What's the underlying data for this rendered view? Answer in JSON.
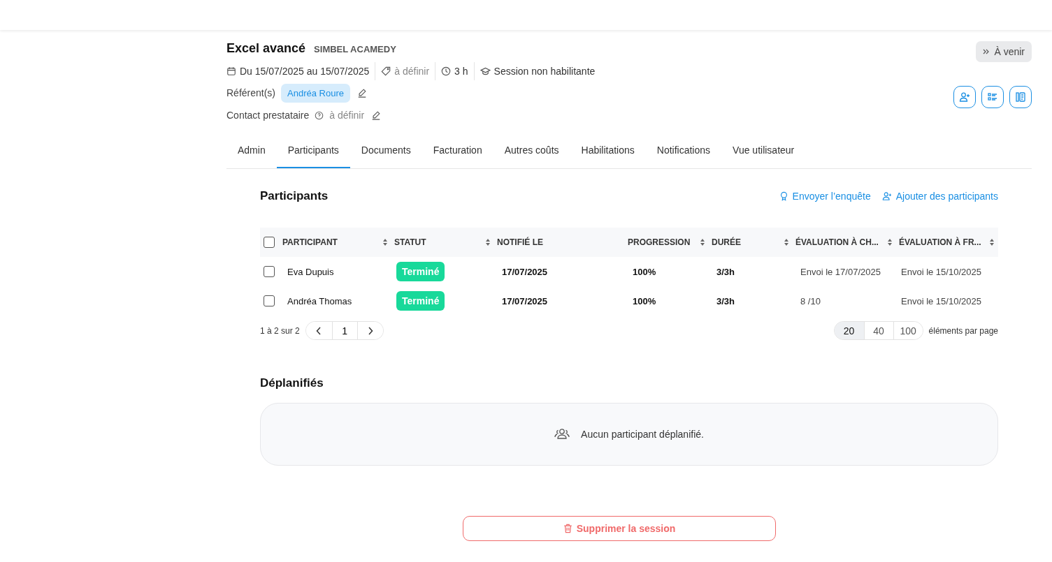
{
  "session": {
    "title": "Excel avancé",
    "provider": "SIMBEL ACAMEDY",
    "status": "À venir",
    "dates": "Du 15/07/2025 au 15/07/2025",
    "price": "à définir",
    "duration": "3 h",
    "qualification": "Session non habilitante"
  },
  "referents": {
    "label": "Référent(s)",
    "chips": [
      "Andréa Roure"
    ]
  },
  "contact": {
    "label": "Contact prestataire",
    "value": "à définir"
  },
  "tabs": [
    {
      "label": "Admin",
      "selected": false
    },
    {
      "label": "Participants",
      "selected": true
    },
    {
      "label": "Documents",
      "selected": false
    },
    {
      "label": "Facturation",
      "selected": false
    },
    {
      "label": "Autres coûts",
      "selected": false
    },
    {
      "label": "Habilitations",
      "selected": false
    },
    {
      "label": "Notifications",
      "selected": false
    },
    {
      "label": "Vue utilisateur",
      "selected": false
    }
  ],
  "participants": {
    "title": "Participants",
    "actions": [
      "Envoyer l’enquête",
      "Ajouter des participants"
    ],
    "columns": [
      {
        "label": "PARTICIPANT",
        "sortable": true
      },
      {
        "label": "STATUT",
        "sortable": true
      },
      {
        "label": "NOTIFIÉ LE",
        "sortable": false
      },
      {
        "label": "PROGRESSION",
        "sortable": true
      },
      {
        "label": "DURÉE",
        "sortable": true
      },
      {
        "label": "ÉVALUATION À CH...",
        "sortable": true
      },
      {
        "label": "ÉVALUATION À FR...",
        "sortable": true
      }
    ],
    "rows": [
      {
        "checked": false,
        "name": "Eva Dupuis",
        "status": "Terminé",
        "notified": "17/07/2025",
        "progress": "100%",
        "duration": "3/3h",
        "eval_hot": "Envoi le 17/07/2025",
        "eval_cold": "Envoi le 15/10/2025"
      },
      {
        "checked": false,
        "name": "Andréa Thomas",
        "status": "Terminé",
        "notified": "17/07/2025",
        "progress": "100%",
        "duration": "3/3h",
        "eval_hot": "8 /10",
        "eval_cold": "Envoi le 15/10/2025"
      }
    ],
    "all_selected": false,
    "range": "1 à 2 sur 2",
    "pages": [
      {
        "label": "1"
      }
    ],
    "page_sizes": [
      {
        "label": "20",
        "selected": true
      },
      {
        "label": "40",
        "selected": false
      },
      {
        "label": "100",
        "selected": false
      }
    ],
    "per_page_label": "éléments par page"
  },
  "unplanned": {
    "title": "Déplanifiés",
    "empty": "Aucun participant déplanifié."
  },
  "delete_button": "Supprimer la session"
}
